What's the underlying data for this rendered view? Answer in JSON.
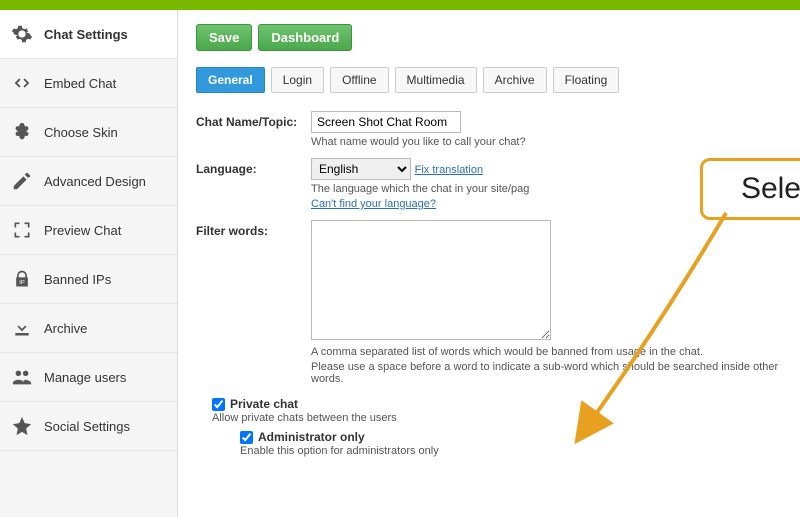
{
  "sidebar": {
    "items": [
      {
        "label": "Chat Settings"
      },
      {
        "label": "Embed Chat"
      },
      {
        "label": "Choose Skin"
      },
      {
        "label": "Advanced Design"
      },
      {
        "label": "Preview Chat"
      },
      {
        "label": "Banned IPs"
      },
      {
        "label": "Archive"
      },
      {
        "label": "Manage users"
      },
      {
        "label": "Social Settings"
      }
    ]
  },
  "buttons": {
    "save": "Save",
    "dashboard": "Dashboard"
  },
  "tabs": {
    "general": "General",
    "login": "Login",
    "offline": "Offline",
    "multimedia": "Multimedia",
    "archive": "Archive",
    "floating": "Floating"
  },
  "fields": {
    "chat_name": {
      "label": "Chat Name/Topic:",
      "value": "Screen Shot Chat Room",
      "help": "What name would you like to call your chat?"
    },
    "language": {
      "label": "Language:",
      "value": "English",
      "fix_link": "Fix translation",
      "help": "The language which the chat in your site/pag",
      "find_link": "Can't find your language?"
    },
    "filter": {
      "label": "Filter words:",
      "help1": "A comma separated list of words which would be banned from usage in the chat.",
      "help2": "Please use a space before a word to indicate a sub-word which should be searched inside other words."
    },
    "private": {
      "label": "Private chat",
      "help": "Allow private chats between the users"
    },
    "admin": {
      "label": "Administrator only",
      "help": "Enable this option for administrators only"
    }
  },
  "callout": {
    "text": "Select both"
  }
}
